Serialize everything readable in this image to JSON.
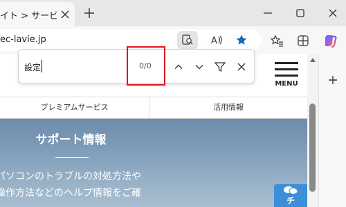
{
  "browser": {
    "tab": {
      "title": "イト > サービス＆サ"
    },
    "address": {
      "url": "ec-lavie.jp"
    }
  },
  "find_bar": {
    "query": "設定",
    "match_count": "0/0"
  },
  "site": {
    "menu_label": "MENU",
    "subnav": [
      "プレミアムサービス",
      "活用情報"
    ],
    "hero": {
      "title": "サポート情報",
      "lines": [
        "パソコンのトラブルの対処方法や",
        "操作方法などのヘルプ情報をご確"
      ]
    },
    "chat_badge": {
      "label": "チ"
    }
  },
  "colors": {
    "accent_blue": "#0f6cbd",
    "find_highlight": "#e0141e",
    "chat_badge": "#3a8fd8"
  },
  "icons": [
    "close-icon",
    "new-tab-icon",
    "minimize-icon",
    "maximize-icon",
    "read-aloud-icon",
    "favorite-star-icon",
    "favorites-icon",
    "extensions-icon",
    "copilot-icon",
    "chevron-up-icon",
    "chevron-down-icon",
    "filter-icon",
    "plus-icon"
  ]
}
